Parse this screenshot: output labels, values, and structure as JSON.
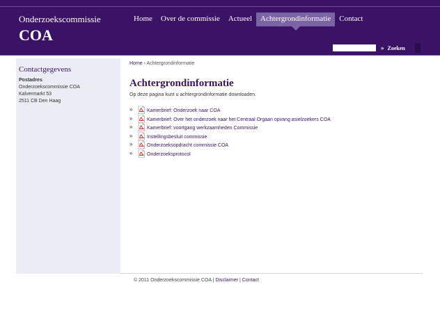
{
  "header": {
    "brand_subtitle": "Onderzoekscommissie",
    "brand_title": "COA",
    "colors": {
      "primary": "#3b1366",
      "active_tab": "#7b64a3"
    }
  },
  "nav": {
    "items": [
      {
        "label": "Home",
        "active": false
      },
      {
        "label": "Over de commissie",
        "active": false
      },
      {
        "label": "Actueel",
        "active": false
      },
      {
        "label": "Achtergrondinformatie",
        "active": true
      },
      {
        "label": "Contact",
        "active": false
      }
    ]
  },
  "search": {
    "value": "",
    "button_label": "Zoeken",
    "button_icon": "double-chevron-right-icon"
  },
  "sidebar": {
    "title": "Contactgegevens",
    "address_label": "Postadres",
    "address_lines": [
      "Onderzoekscommissie COA",
      "Kalvermarkt 53",
      "2511 CB Den Haag"
    ]
  },
  "breadcrumb": {
    "home": "Home",
    "separator": "›",
    "current": "Achtergrondinformatie"
  },
  "main": {
    "title": "Achtergrondinformatie",
    "intro": "Op deze pagina kunt u achtergrondinformatie downloaden.",
    "documents": [
      {
        "label": "Kamerbrief: Onderzoek naar COA",
        "icon": "pdf-icon"
      },
      {
        "label": "Kamerbrief: Over het onderzoek naar het Centraal Orgaan opvang asielzoekers COA",
        "icon": "pdf-icon"
      },
      {
        "label": "Kamerbrief: voortgang werkzaamheden Commissie",
        "icon": "pdf-icon"
      },
      {
        "label": "Instellingsbesluit commissie",
        "icon": "pdf-icon"
      },
      {
        "label": "Onderzoeksopdracht commissie COA",
        "icon": "pdf-icon"
      },
      {
        "label": "Onderzoeksprotocol",
        "icon": "pdf-icon"
      }
    ]
  },
  "footer": {
    "copyright": "© 2011 Onderzoekscommissie COA",
    "separator": "|",
    "disclaimer": "Disclaimer",
    "contact": "Contact"
  }
}
